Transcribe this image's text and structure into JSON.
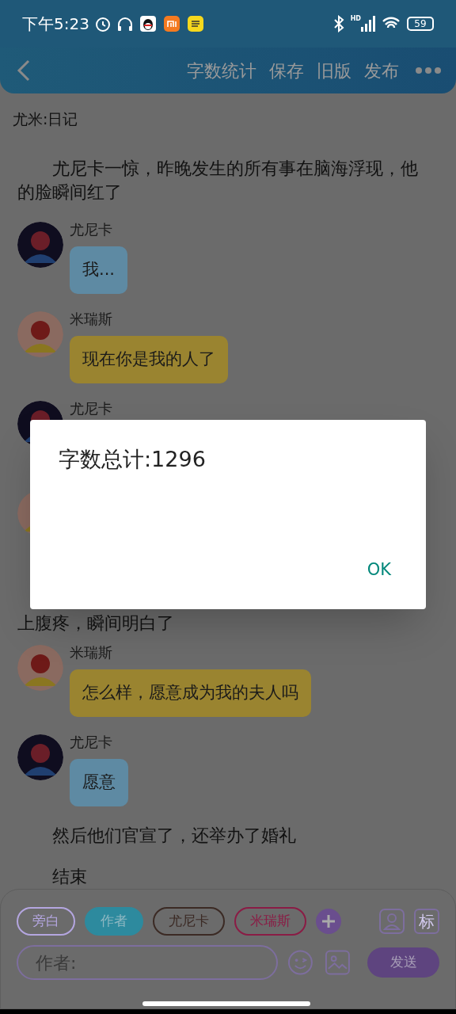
{
  "status_bar": {
    "time": "下午5:23",
    "network": "HD",
    "battery": "59"
  },
  "header": {
    "actions": [
      "字数统计",
      "保存",
      "旧版",
      "发布"
    ]
  },
  "document": {
    "title": "尤米:日记",
    "entries": [
      {
        "kind": "narration",
        "text": "尤尼卡一惊，昨晚发生的所有事在脑海浮现，他的脸瞬间红了"
      },
      {
        "kind": "message",
        "speaker": "尤尼卡",
        "text": "我...",
        "color": "#5e8aa3"
      },
      {
        "kind": "reply",
        "speaker": "米瑞斯",
        "text": "现在你是我的人了",
        "color": "#9a8430"
      },
      {
        "kind": "message",
        "speaker": "尤尼卡"
      },
      {
        "kind": "reply"
      },
      {
        "kind": "tail",
        "text": "上腹疼，瞬间明白了"
      },
      {
        "kind": "reply",
        "speaker": "米瑞斯",
        "text": "怎么样，愿意成为我的夫人吗",
        "color": "#9a8430"
      },
      {
        "kind": "message",
        "speaker": "尤尼卡",
        "text": "愿意",
        "color": "#5e8aa3"
      },
      {
        "kind": "narration",
        "text": "然后他们官宣了，还举办了婚礼"
      },
      {
        "kind": "narration",
        "text": "结束"
      }
    ]
  },
  "composer": {
    "roles": [
      {
        "label": "旁白",
        "selected": false,
        "color": "#b4a6e0"
      },
      {
        "label": "作者",
        "selected": true,
        "color": "#2d8a9e"
      },
      {
        "label": "尤尼卡",
        "selected": false,
        "color": "#3b2a24"
      },
      {
        "label": "米瑞斯",
        "selected": false,
        "color": "#8a1c45"
      }
    ],
    "tag_button": "标",
    "input": {
      "placeholder": "作者:"
    },
    "send": "发送"
  },
  "dialog": {
    "message": "字数总计:1296",
    "button": "OK"
  }
}
